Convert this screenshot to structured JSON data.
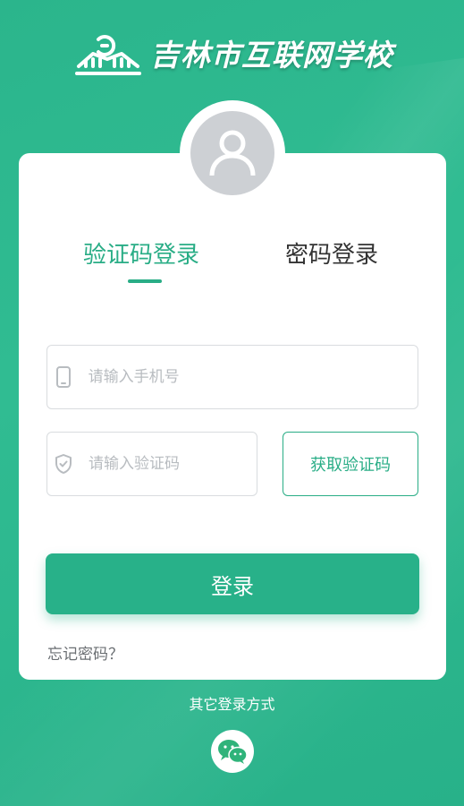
{
  "branding": {
    "school_name": "吉林市互联网学校",
    "logo_icon": "book-g-logo-icon"
  },
  "colors": {
    "primary": "#29ad86",
    "background": "#29b38a",
    "card": "#ffffff",
    "avatar": "#cdd0d4"
  },
  "avatar": {
    "icon": "user-avatar-icon"
  },
  "tabs": [
    {
      "label": "验证码登录",
      "active": true
    },
    {
      "label": "密码登录",
      "active": false
    }
  ],
  "form": {
    "phone": {
      "placeholder": "请输入手机号",
      "value": "",
      "icon": "phone-icon"
    },
    "code": {
      "placeholder": "请输入验证码",
      "value": "",
      "icon": "shield-check-icon"
    },
    "get_code_label": "获取验证码",
    "login_label": "登录",
    "forgot_label": "忘记密码？"
  },
  "alt_login": {
    "label": "其它登录方式",
    "wechat_icon": "wechat-icon"
  }
}
